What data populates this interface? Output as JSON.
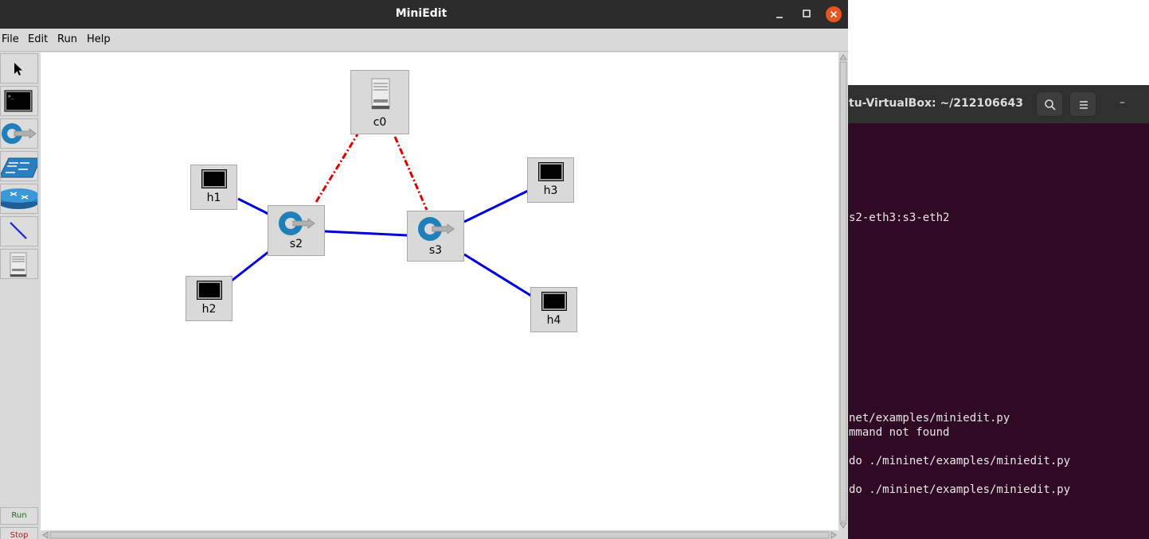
{
  "terminal": {
    "title": "tu-VirtualBox: ~/212106643",
    "minimize": "–",
    "lines": [
      "s2-eth3:s3-eth2",
      "net/examples/miniedit.py",
      "mmand not found",
      "do ./mininet/examples/miniedit.py",
      "do ./mininet/examples/miniedit.py"
    ]
  },
  "window": {
    "title": "MiniEdit"
  },
  "menu": {
    "file": "File",
    "edit": "Edit",
    "run": "Run",
    "help": "Help"
  },
  "toolbar": {
    "run": "Run",
    "stop": "Stop"
  },
  "nodes": {
    "c0": "c0",
    "s2": "s2",
    "s3": "s3",
    "h1": "h1",
    "h2": "h2",
    "h3": "h3",
    "h4": "h4"
  },
  "colors": {
    "accent": "#e95420",
    "link": "#0000d8",
    "control_link": "#e00000",
    "run_text": "#1d6b1d",
    "stop_text": "#a02020"
  }
}
